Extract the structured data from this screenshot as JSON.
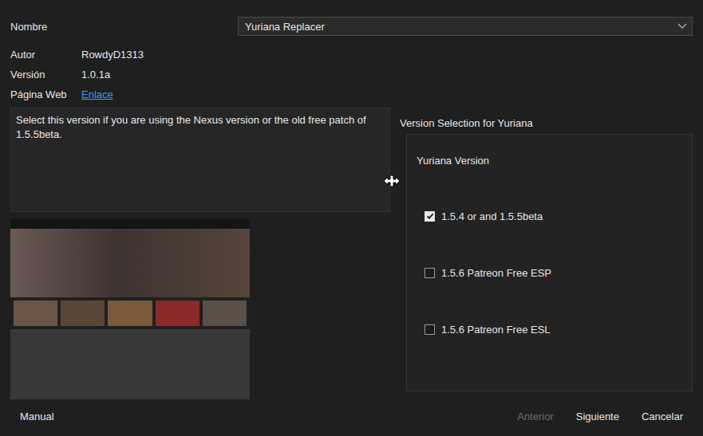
{
  "window": {
    "name_label": "Nombre",
    "name_value": "Yuriana Replacer"
  },
  "fields": [
    {
      "label": "Autor",
      "value": "RowdyD1313",
      "kind": "text"
    },
    {
      "label": "Versión",
      "value": "1.0.1a",
      "kind": "text"
    },
    {
      "label": "Página Web",
      "value": "Enlace",
      "kind": "link"
    }
  ],
  "description": "Select this version if you are using the Nexus version or the old free patch of 1.5.5beta.",
  "group_title": "Version Selection for Yuriana",
  "option_group": {
    "title": "Yuriana Version",
    "options": [
      {
        "label": "1.5.4 or and 1.5.5beta",
        "checked": true
      },
      {
        "label": "1.5.6 Patreon Free ESP",
        "checked": false
      },
      {
        "label": "1.5.6 Patreon Free ESL",
        "checked": false
      }
    ]
  },
  "manual_button": {
    "label": "Manual",
    "disabled": false
  },
  "nav_buttons": [
    {
      "label": "Anterior",
      "disabled": true
    },
    {
      "label": "Siguiente",
      "disabled": false
    },
    {
      "label": "Cancelar",
      "disabled": false
    }
  ]
}
